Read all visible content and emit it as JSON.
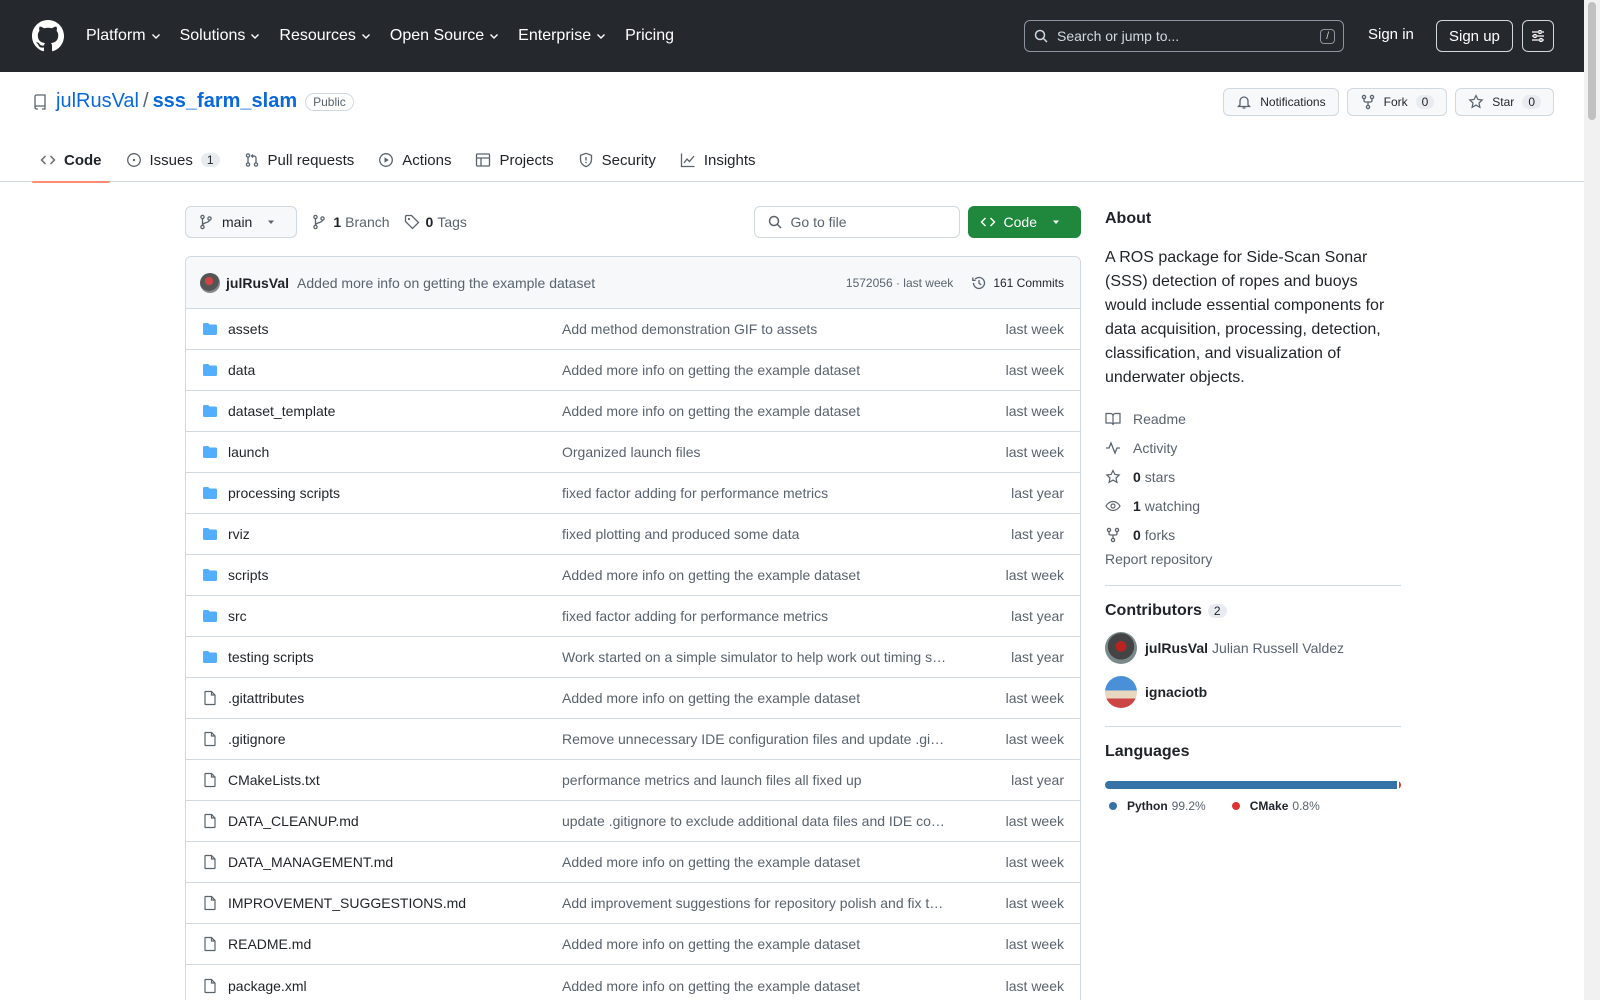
{
  "header": {
    "nav": [
      "Platform",
      "Solutions",
      "Resources",
      "Open Source",
      "Enterprise",
      "Pricing"
    ],
    "search_placeholder": "Search or jump to...",
    "search_shortcut": "/",
    "sign_in": "Sign in",
    "sign_up": "Sign up"
  },
  "repo": {
    "owner": "julRusVal",
    "separator": "/",
    "name": "sss_farm_slam",
    "visibility": "Public",
    "notifications_label": "Notifications",
    "fork_label": "Fork",
    "fork_count": "0",
    "star_label": "Star",
    "star_count": "0"
  },
  "tabs": [
    {
      "label": "Code",
      "icon": "code-icon"
    },
    {
      "label": "Issues",
      "count": "1",
      "icon": "issue-icon"
    },
    {
      "label": "Pull requests",
      "icon": "pull-request-icon"
    },
    {
      "label": "Actions",
      "icon": "play-icon"
    },
    {
      "label": "Projects",
      "icon": "table-icon"
    },
    {
      "label": "Security",
      "icon": "shield-icon"
    },
    {
      "label": "Insights",
      "icon": "graph-icon"
    }
  ],
  "toolbar": {
    "branch": "main",
    "branch_count": "1",
    "branch_label": "Branch",
    "tag_count": "0",
    "tag_label": "Tags",
    "goto_placeholder": "Go to file",
    "code_button": "Code"
  },
  "latest_commit": {
    "author": "julRusVal",
    "message": "Added more info on getting the example dataset",
    "hash_time": "1572056 · last week",
    "commits": "161 Commits"
  },
  "files": [
    {
      "name": "assets",
      "type": "dir",
      "message": "Add method demonstration GIF to assets",
      "date": "last week"
    },
    {
      "name": "data",
      "type": "dir",
      "message": "Added more info on getting the example dataset",
      "date": "last week"
    },
    {
      "name": "dataset_template",
      "type": "dir",
      "message": "Added more info on getting the example dataset",
      "date": "last week"
    },
    {
      "name": "launch",
      "type": "dir",
      "message": "Organized launch files",
      "date": "last week"
    },
    {
      "name": "processing scripts",
      "type": "dir",
      "message": "fixed factor adding for performance metrics",
      "date": "last year"
    },
    {
      "name": "rviz",
      "type": "dir",
      "message": "fixed plotting and produced some data",
      "date": "last year"
    },
    {
      "name": "scripts",
      "type": "dir",
      "message": "Added more info on getting the example dataset",
      "date": "last week"
    },
    {
      "name": "src",
      "type": "dir",
      "message": "fixed factor adding for performance metrics",
      "date": "last year"
    },
    {
      "name": "testing scripts",
      "type": "dir",
      "message": "Work started on a simple simulator to help work out timing s…",
      "date": "last year"
    },
    {
      "name": ".gitattributes",
      "type": "file",
      "message": "Added more info on getting the example dataset",
      "date": "last week"
    },
    {
      "name": ".gitignore",
      "type": "file",
      "message": "Remove unnecessary IDE configuration files and update .gi…",
      "date": "last week"
    },
    {
      "name": "CMakeLists.txt",
      "type": "file",
      "message": "performance metrics and launch files all fixed up",
      "date": "last year"
    },
    {
      "name": "DATA_CLEANUP.md",
      "type": "file",
      "message": "update .gitignore to exclude additional data files and IDE co…",
      "date": "last week"
    },
    {
      "name": "DATA_MANAGEMENT.md",
      "type": "file",
      "message": "Added more info on getting the example dataset",
      "date": "last week"
    },
    {
      "name": "IMPROVEMENT_SUGGESTIONS.md",
      "type": "file",
      "message": "Add improvement suggestions for repository polish and fix t…",
      "date": "last week"
    },
    {
      "name": "README.md",
      "type": "file",
      "message": "Added more info on getting the example dataset",
      "date": "last week"
    },
    {
      "name": "package.xml",
      "type": "file",
      "message": "Added more info on getting the example dataset",
      "date": "last week"
    }
  ],
  "about": {
    "title": "About",
    "description": "A ROS package for Side-Scan Sonar (SSS) detection of ropes and buoys would include essential components for data acquisition, processing, detection, classification, and visualization of underwater objects.",
    "readme": "Readme",
    "activity": "Activity",
    "stars_count": "0",
    "stars_label": "stars",
    "watching_count": "1",
    "watching_label": "watching",
    "forks_count": "0",
    "forks_label": "forks",
    "report": "Report repository"
  },
  "contributors": {
    "title": "Contributors",
    "count": "2",
    "list": [
      {
        "login": "julRusVal",
        "full_name": "Julian Russell Valdez"
      },
      {
        "login": "ignaciotb",
        "full_name": ""
      }
    ]
  },
  "languages": {
    "title": "Languages",
    "items": [
      {
        "name": "Python",
        "percent": "99.2%",
        "value": 99.2,
        "color": "#3572A5"
      },
      {
        "name": "CMake",
        "percent": "0.8%",
        "value": 0.8,
        "color": "#DA3434"
      }
    ]
  },
  "colors": {
    "header_bg": "#25292e",
    "accent": "#0969da",
    "code_button": "#1f883d",
    "tab_underline": "#fd8c73",
    "folder": "#54aeff"
  }
}
